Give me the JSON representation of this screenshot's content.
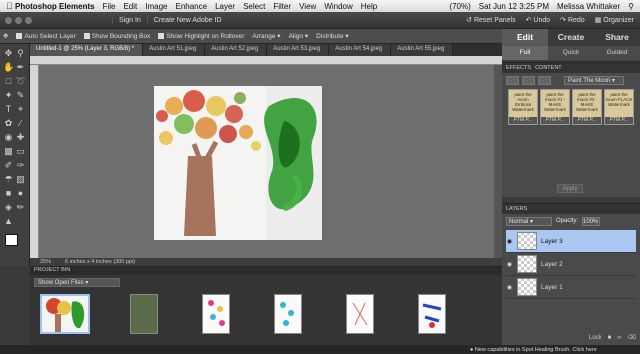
{
  "menubar": {
    "app": "Photoshop Elements",
    "items": [
      "File",
      "Edit",
      "Image",
      "Enhance",
      "Layer",
      "Select",
      "Filter",
      "View",
      "Window",
      "Help"
    ],
    "battery": "(70%)",
    "clock": "Sat Jun 12  3:25 PM",
    "user": "Melissa Whittaker"
  },
  "header": {
    "sign_in": "Sign In",
    "create_id": "Create New Adobe ID",
    "reset_panels": "Reset Panels",
    "undo": "Undo",
    "redo": "Redo",
    "organizer": "Organizer"
  },
  "options": {
    "auto_select": "Auto Select Layer",
    "show_bbox": "Show Bounding Box",
    "show_highlight": "Show Highlight on Rollover",
    "arrange": "Arrange",
    "align": "Align",
    "distribute": "Distribute"
  },
  "tabs": [
    {
      "label": "Untitled-1 @ 25% (Layer 3, RGB/8) *"
    },
    {
      "label": "Austin Art 51.jpeg"
    },
    {
      "label": "Austin Art 52.jpeg"
    },
    {
      "label": "Austin Art 53.jpeg"
    },
    {
      "label": "Austin Art 54.jpeg"
    },
    {
      "label": "Austin Art 55.jpeg"
    }
  ],
  "status": {
    "zoom": "25%",
    "doc_size": "6 inches x 4 inches (300 ppi)"
  },
  "bin": {
    "title": "PROJECT BIN",
    "show": "Show Open Files"
  },
  "modes": {
    "edit": "Edit",
    "create": "Create",
    "share": "Share",
    "full": "Full",
    "quick": "Quick",
    "guided": "Guided"
  },
  "effects": {
    "tab_effects": "EFFECTS",
    "tab_content": "CONTENT",
    "category": "Paint The Moon",
    "items": [
      {
        "img": "paint the moon Emboss Watermark",
        "label": "PTM P..."
      },
      {
        "img": "paint the moon #1 - MAKE Watermark",
        "label": "PTM P..."
      },
      {
        "img": "paint the moon #2 - MAKE Watermark",
        "label": "PTM P..."
      },
      {
        "img": "paint the moon FLACK Watermark",
        "label": "PTM P..."
      }
    ],
    "apply": "Apply"
  },
  "layers": {
    "title": "LAYERS",
    "blend": "Normal",
    "opacity_label": "Opacity:",
    "opacity": "100%",
    "items": [
      {
        "name": "Layer 3"
      },
      {
        "name": "Layer 2"
      },
      {
        "name": "Layer 1"
      }
    ],
    "lock": "Lock"
  },
  "footer": {
    "tip": "New capabilities in Spot Healing Brush. Click here"
  }
}
